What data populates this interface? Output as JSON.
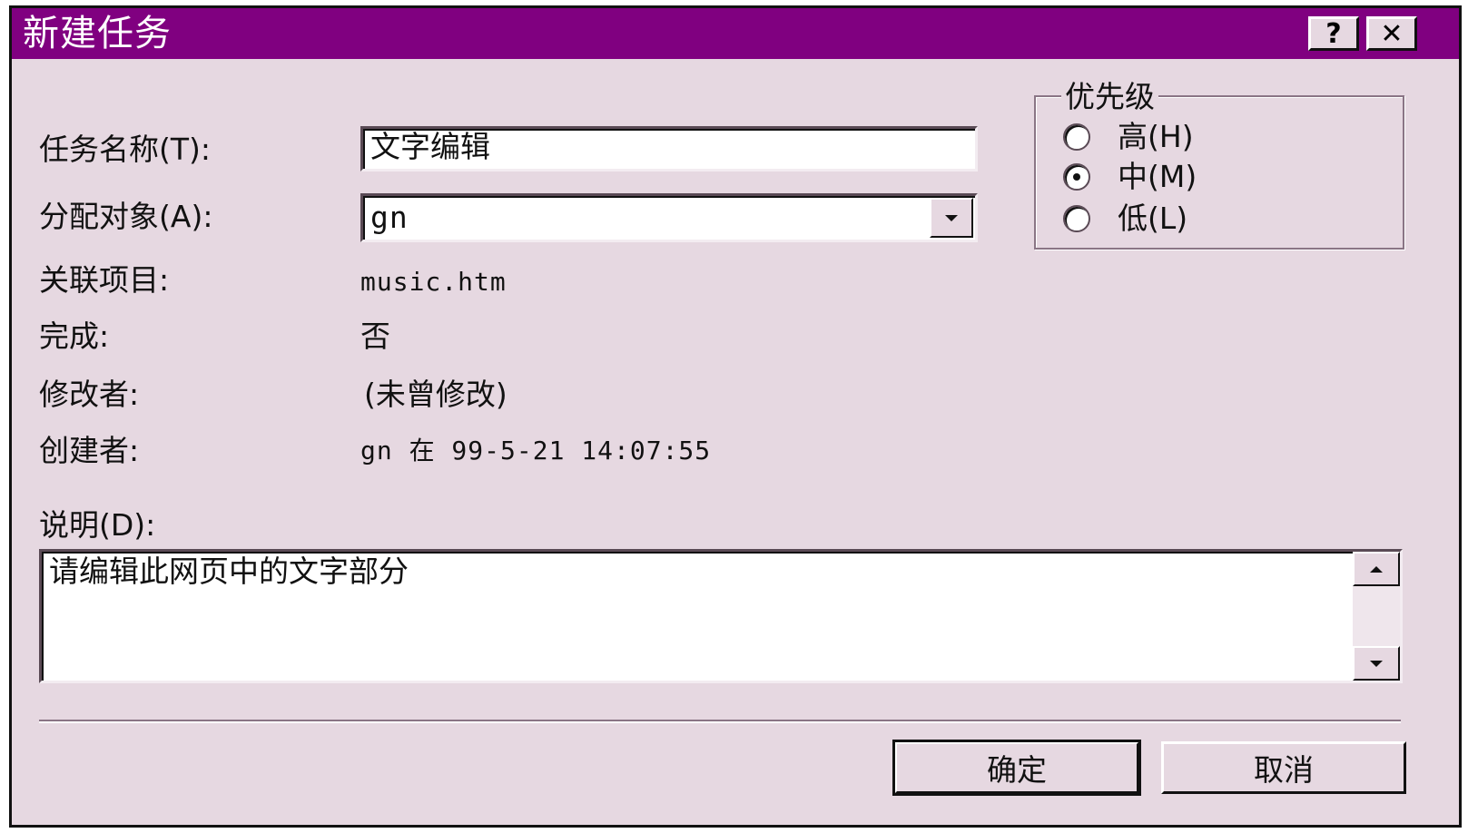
{
  "dialog": {
    "title": "新建任务",
    "help_button": "?",
    "close_button": "✕"
  },
  "fields": {
    "task_name_label": "任务名称(T):",
    "task_name_value": "文字编辑",
    "assign_label": "分配对象(A):",
    "assign_value": "gn",
    "project_label": "关联项目:",
    "project_value": "music.htm",
    "done_label": "完成:",
    "done_value": "否",
    "modified_label": "修改者:",
    "modified_value": "(未曾修改)",
    "created_label": "创建者:",
    "created_value": "gn 在 99-5-21 14:07:55",
    "desc_label": "说明(D):",
    "desc_value": "请编辑此网页中的文字部分"
  },
  "priority": {
    "legend": "优先级",
    "options": [
      {
        "label": "高(H)",
        "selected": false
      },
      {
        "label": "中(M)",
        "selected": true
      },
      {
        "label": "低(L)",
        "selected": false
      }
    ]
  },
  "buttons": {
    "ok": "确定",
    "cancel": "取消"
  },
  "colors": {
    "titlebar": "#800080",
    "dialog_bg": "#e6d8e1"
  }
}
